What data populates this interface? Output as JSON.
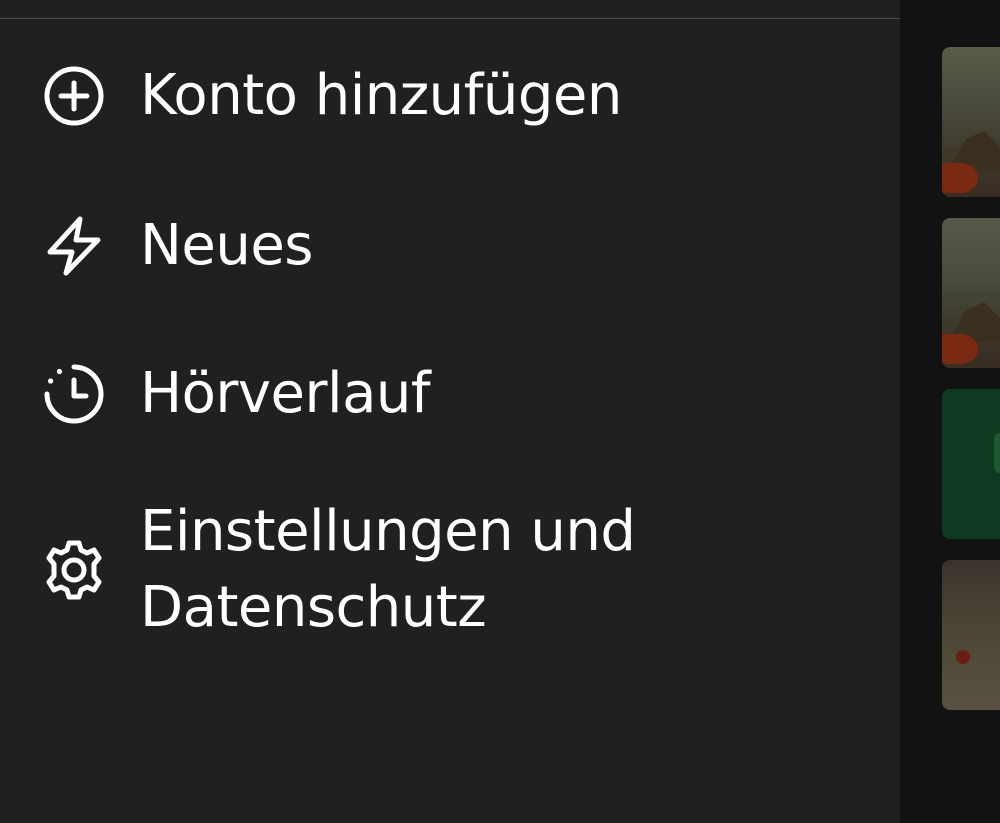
{
  "menu": {
    "add_account": {
      "label": "Konto hinzufügen",
      "icon": "plus-circle-icon"
    },
    "whats_new": {
      "label": "Neues",
      "icon": "lightning-icon"
    },
    "listening_history": {
      "label": "Hörverlauf",
      "icon": "history-clock-icon"
    },
    "settings": {
      "label": "Einstellungen und Datenschutz",
      "icon": "gear-icon"
    }
  },
  "colors": {
    "drawer_background": "#202020",
    "text": "#ffffff",
    "app_background": "#121212"
  }
}
